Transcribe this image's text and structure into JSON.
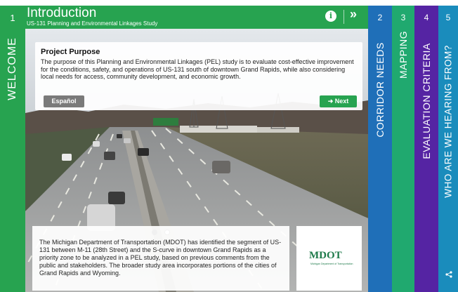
{
  "header": {
    "title": "Introduction",
    "subtitle": "US-131 Planning and Environmental Linkages Study",
    "info_icon": "i",
    "expand_icon": "»"
  },
  "welcome_tab": {
    "number": "1",
    "label": "WELCOME"
  },
  "tabs": [
    {
      "number": "2",
      "label": "CORRIDOR NEEDS",
      "color": "#1f6fb8"
    },
    {
      "number": "3",
      "label": "MAPPING",
      "color": "#20a96f"
    },
    {
      "number": "4",
      "label": "EVALUATION CRITERIA",
      "color": "#5524a3"
    },
    {
      "number": "5",
      "label": "WHO ARE WE HEARING FROM?",
      "color": "#1a8cbc"
    }
  ],
  "purpose": {
    "heading": "Project Purpose",
    "body": "The purpose of this Planning and Environmental Linkages (PEL) study is to evaluate cost-effective improvement for the conditions, safety, and operations of US-131 south of downtown Grand Rapids, while also considering local needs for access, community development, and economic growth."
  },
  "buttons": {
    "espanol": "Español",
    "next": "➜ Next"
  },
  "info": {
    "body": "The Michigan Department of Transportation (MDOT) has identified the segment of US-131 between M-11 (28th Street) and the S-curve in downtown Grand Rapids as a priority zone to be analyzed in a PEL study, based on previous comments from the public and stakeholders. The broader study area incorporates portions of the cities of Grand Rapids and Wyoming."
  },
  "logo": {
    "text": "MDOT",
    "subtext": "Michigan Department of Transportation"
  },
  "colors": {
    "primary_green": "#27a350",
    "tab_blue": "#1f6fb8",
    "tab_teal": "#20a96f",
    "tab_purple": "#5524a3",
    "tab_lightblue": "#1a8cbc"
  },
  "icons": [
    "info-icon",
    "double-chevron-right-icon",
    "share-icon",
    "arrow-right-icon"
  ]
}
